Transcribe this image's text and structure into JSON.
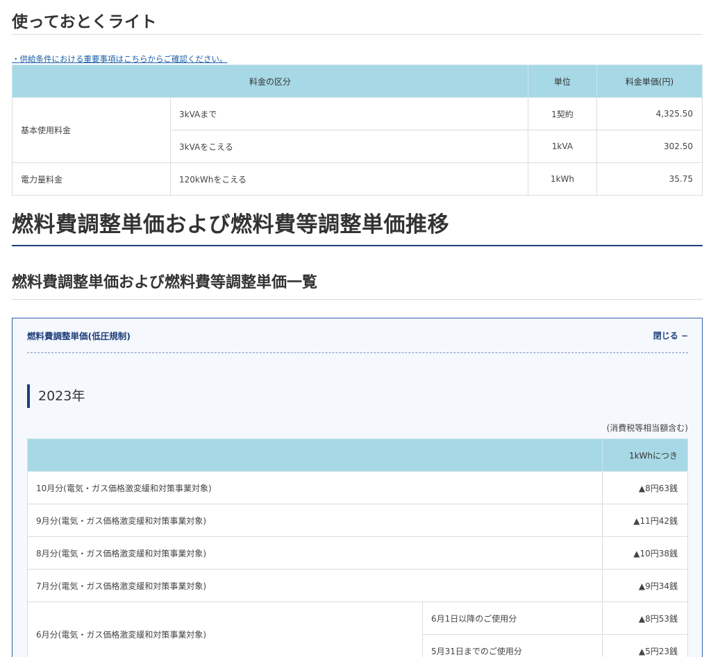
{
  "section1": {
    "title": "使っておとくライト",
    "notice_link": "・供給条件における重要事項はこちらからご確認ください。"
  },
  "price_table": {
    "headers": {
      "category": "料金の区分",
      "unit": "単位",
      "price": "料金単価(円)"
    },
    "basic": {
      "label": "基本使用料金",
      "rows": [
        {
          "tier": "3kVAまで",
          "unit": "1契約",
          "price": "4,325.50"
        },
        {
          "tier": "3kVAをこえる",
          "unit": "1kVA",
          "price": "302.50"
        }
      ]
    },
    "energy": {
      "label": "電力量料金",
      "tier": "120kWhをこえる",
      "unit": "1kWh",
      "price": "35.75"
    }
  },
  "headings": {
    "big": "燃料費調整単価および燃料費等調整単価推移",
    "mid": "燃料費調整単価および燃料費等調整単価一覧"
  },
  "panel": {
    "title": "燃料費調整単価(低圧規制)",
    "toggle_label": "閉じる −",
    "year": "2023年",
    "tax_note": "(消費税等相当額含む)",
    "unit_header": "1kWhにつき",
    "rows": [
      {
        "month": "10月分(電気・ガス価格激変緩和対策事業対象)",
        "value": "▲8円63銭"
      },
      {
        "month": "9月分(電気・ガス価格激変緩和対策事業対象)",
        "value": "▲11円42銭"
      },
      {
        "month": "8月分(電気・ガス価格激変緩和対策事業対象)",
        "value": "▲10円38銭"
      },
      {
        "month": "7月分(電気・ガス価格激変緩和対策事業対象)",
        "value": "▲9円34銭"
      }
    ],
    "june": {
      "month": "6月分(電気・ガス価格激変緩和対策事業対象)",
      "after": {
        "period": "6月1日以降のご使用分",
        "value": "▲8円53銭"
      },
      "before": {
        "period": "5月31日までのご使用分",
        "value": "▲5円23銭"
      }
    }
  }
}
